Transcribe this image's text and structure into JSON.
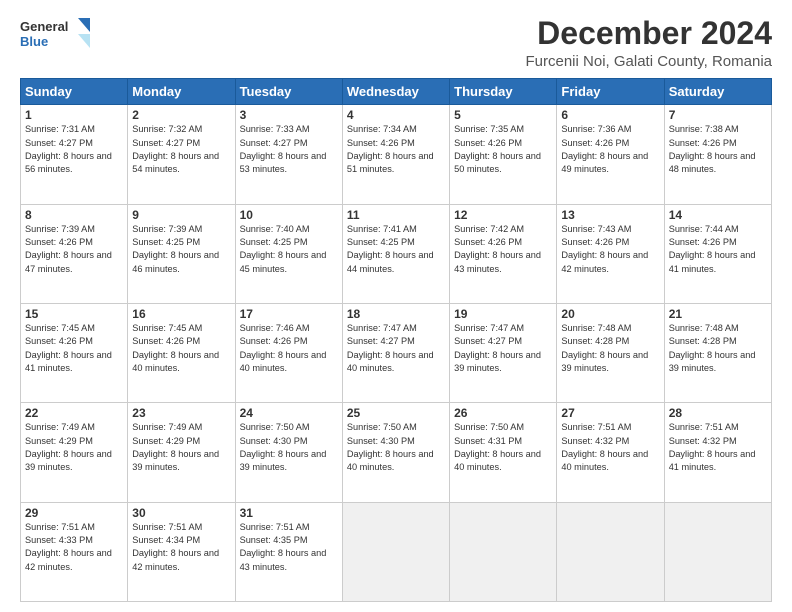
{
  "header": {
    "logo_general": "General",
    "logo_blue": "Blue",
    "month_year": "December 2024",
    "location": "Furcenii Noi, Galati County, Romania"
  },
  "weekdays": [
    "Sunday",
    "Monday",
    "Tuesday",
    "Wednesday",
    "Thursday",
    "Friday",
    "Saturday"
  ],
  "weeks": [
    [
      {
        "day": "1",
        "sunrise": "Sunrise: 7:31 AM",
        "sunset": "Sunset: 4:27 PM",
        "daylight": "Daylight: 8 hours and 56 minutes."
      },
      {
        "day": "2",
        "sunrise": "Sunrise: 7:32 AM",
        "sunset": "Sunset: 4:27 PM",
        "daylight": "Daylight: 8 hours and 54 minutes."
      },
      {
        "day": "3",
        "sunrise": "Sunrise: 7:33 AM",
        "sunset": "Sunset: 4:27 PM",
        "daylight": "Daylight: 8 hours and 53 minutes."
      },
      {
        "day": "4",
        "sunrise": "Sunrise: 7:34 AM",
        "sunset": "Sunset: 4:26 PM",
        "daylight": "Daylight: 8 hours and 51 minutes."
      },
      {
        "day": "5",
        "sunrise": "Sunrise: 7:35 AM",
        "sunset": "Sunset: 4:26 PM",
        "daylight": "Daylight: 8 hours and 50 minutes."
      },
      {
        "day": "6",
        "sunrise": "Sunrise: 7:36 AM",
        "sunset": "Sunset: 4:26 PM",
        "daylight": "Daylight: 8 hours and 49 minutes."
      },
      {
        "day": "7",
        "sunrise": "Sunrise: 7:38 AM",
        "sunset": "Sunset: 4:26 PM",
        "daylight": "Daylight: 8 hours and 48 minutes."
      }
    ],
    [
      {
        "day": "8",
        "sunrise": "Sunrise: 7:39 AM",
        "sunset": "Sunset: 4:26 PM",
        "daylight": "Daylight: 8 hours and 47 minutes."
      },
      {
        "day": "9",
        "sunrise": "Sunrise: 7:39 AM",
        "sunset": "Sunset: 4:25 PM",
        "daylight": "Daylight: 8 hours and 46 minutes."
      },
      {
        "day": "10",
        "sunrise": "Sunrise: 7:40 AM",
        "sunset": "Sunset: 4:25 PM",
        "daylight": "Daylight: 8 hours and 45 minutes."
      },
      {
        "day": "11",
        "sunrise": "Sunrise: 7:41 AM",
        "sunset": "Sunset: 4:25 PM",
        "daylight": "Daylight: 8 hours and 44 minutes."
      },
      {
        "day": "12",
        "sunrise": "Sunrise: 7:42 AM",
        "sunset": "Sunset: 4:26 PM",
        "daylight": "Daylight: 8 hours and 43 minutes."
      },
      {
        "day": "13",
        "sunrise": "Sunrise: 7:43 AM",
        "sunset": "Sunset: 4:26 PM",
        "daylight": "Daylight: 8 hours and 42 minutes."
      },
      {
        "day": "14",
        "sunrise": "Sunrise: 7:44 AM",
        "sunset": "Sunset: 4:26 PM",
        "daylight": "Daylight: 8 hours and 41 minutes."
      }
    ],
    [
      {
        "day": "15",
        "sunrise": "Sunrise: 7:45 AM",
        "sunset": "Sunset: 4:26 PM",
        "daylight": "Daylight: 8 hours and 41 minutes."
      },
      {
        "day": "16",
        "sunrise": "Sunrise: 7:45 AM",
        "sunset": "Sunset: 4:26 PM",
        "daylight": "Daylight: 8 hours and 40 minutes."
      },
      {
        "day": "17",
        "sunrise": "Sunrise: 7:46 AM",
        "sunset": "Sunset: 4:26 PM",
        "daylight": "Daylight: 8 hours and 40 minutes."
      },
      {
        "day": "18",
        "sunrise": "Sunrise: 7:47 AM",
        "sunset": "Sunset: 4:27 PM",
        "daylight": "Daylight: 8 hours and 40 minutes."
      },
      {
        "day": "19",
        "sunrise": "Sunrise: 7:47 AM",
        "sunset": "Sunset: 4:27 PM",
        "daylight": "Daylight: 8 hours and 39 minutes."
      },
      {
        "day": "20",
        "sunrise": "Sunrise: 7:48 AM",
        "sunset": "Sunset: 4:28 PM",
        "daylight": "Daylight: 8 hours and 39 minutes."
      },
      {
        "day": "21",
        "sunrise": "Sunrise: 7:48 AM",
        "sunset": "Sunset: 4:28 PM",
        "daylight": "Daylight: 8 hours and 39 minutes."
      }
    ],
    [
      {
        "day": "22",
        "sunrise": "Sunrise: 7:49 AM",
        "sunset": "Sunset: 4:29 PM",
        "daylight": "Daylight: 8 hours and 39 minutes."
      },
      {
        "day": "23",
        "sunrise": "Sunrise: 7:49 AM",
        "sunset": "Sunset: 4:29 PM",
        "daylight": "Daylight: 8 hours and 39 minutes."
      },
      {
        "day": "24",
        "sunrise": "Sunrise: 7:50 AM",
        "sunset": "Sunset: 4:30 PM",
        "daylight": "Daylight: 8 hours and 39 minutes."
      },
      {
        "day": "25",
        "sunrise": "Sunrise: 7:50 AM",
        "sunset": "Sunset: 4:30 PM",
        "daylight": "Daylight: 8 hours and 40 minutes."
      },
      {
        "day": "26",
        "sunrise": "Sunrise: 7:50 AM",
        "sunset": "Sunset: 4:31 PM",
        "daylight": "Daylight: 8 hours and 40 minutes."
      },
      {
        "day": "27",
        "sunrise": "Sunrise: 7:51 AM",
        "sunset": "Sunset: 4:32 PM",
        "daylight": "Daylight: 8 hours and 40 minutes."
      },
      {
        "day": "28",
        "sunrise": "Sunrise: 7:51 AM",
        "sunset": "Sunset: 4:32 PM",
        "daylight": "Daylight: 8 hours and 41 minutes."
      }
    ],
    [
      {
        "day": "29",
        "sunrise": "Sunrise: 7:51 AM",
        "sunset": "Sunset: 4:33 PM",
        "daylight": "Daylight: 8 hours and 42 minutes."
      },
      {
        "day": "30",
        "sunrise": "Sunrise: 7:51 AM",
        "sunset": "Sunset: 4:34 PM",
        "daylight": "Daylight: 8 hours and 42 minutes."
      },
      {
        "day": "31",
        "sunrise": "Sunrise: 7:51 AM",
        "sunset": "Sunset: 4:35 PM",
        "daylight": "Daylight: 8 hours and 43 minutes."
      },
      null,
      null,
      null,
      null
    ]
  ]
}
